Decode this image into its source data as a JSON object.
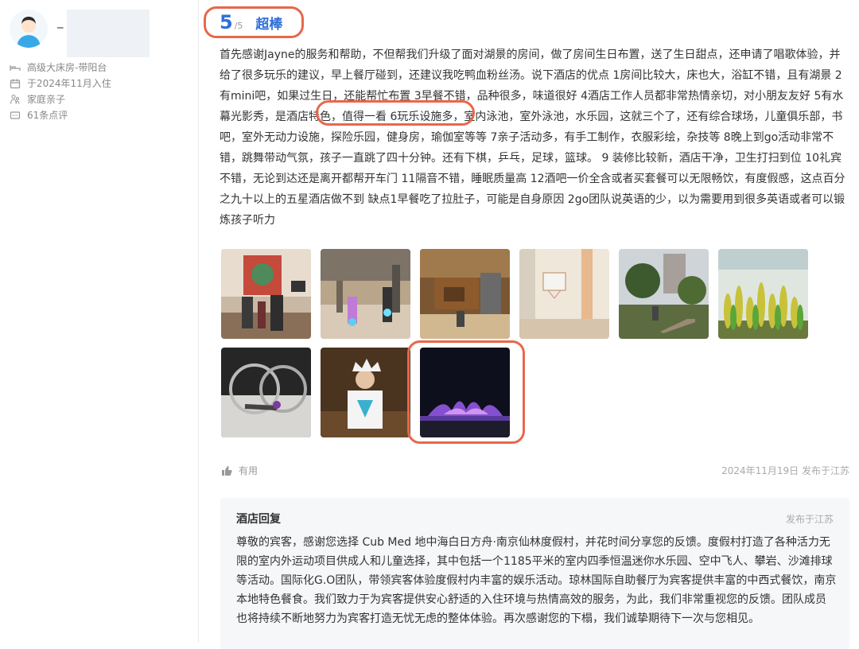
{
  "user": {
    "name_masked": "_ ****",
    "room_type": "高级大床房-带阳台",
    "checkin": "于2024年11月入住",
    "trip_type": "家庭亲子",
    "review_count": "61条点评"
  },
  "rating": {
    "score": "5",
    "out_of": "/5",
    "word": "超棒",
    "color": "#2f6fd8"
  },
  "review": {
    "text": "首先感谢Jayne的服务和帮助，不但帮我们升级了面对湖景的房间，做了房间生日布置，送了生日甜点，还申请了唱歌体验，并给了很多玩乐的建议，早上餐厅碰到，还建议我吃鸭血粉丝汤。说下酒店的优点 1房间比较大，床也大，浴缸不错，且有湖景 2有mini吧，如果过生日，还能帮忙布置 3早餐不错，品种很多，味道很好 4酒店工作人员都非常热情亲切，对小朋友友好 5有水幕光影秀，是酒店特色，值得一看 6玩乐设施多，室内泳池，室外泳池，水乐园，这就三个了，还有综合球场，儿童俱乐部，书吧，室外无动力设施，探险乐园，健身房，瑜伽室等等 7亲子活动多，有手工制作，衣服彩绘，杂技等 8晚上到go活动非常不错，跳舞带动气氛，孩子一直跳了四十分钟。还有下棋，乒乓，足球，篮球。 9 装修比较新，酒店干净，卫生打扫到位 10礼宾不错，无论到达还是离开都帮开车门 11隔音不错，睡眠质量高 12酒吧一价全含或者买套餐可以无限畅饮，有度假感，这点百分之九十以上的五星酒店做不到 缺点1早餐吃了拉肚子，可能是自身原因 2go团队说英语的少，以为需要用到很多英语或者可以锻炼孩子听力"
  },
  "footer": {
    "useful_label": "有用",
    "date_location": "2024年11月19日 发布于江苏"
  },
  "hotel_reply": {
    "title": "酒店回复",
    "location": "发布于江苏",
    "text": "尊敬的宾客，感谢您选择 Cub Med 地中海白日方舟·南京仙林度假村，并花时间分享您的反馈。度假村打造了各种活力无限的室内外运动项目供成人和儿童选择，其中包括一个1185平米的室内四季恒温迷你水乐园、空中飞人、攀岩、沙滩排球等活动。国际化G.O团队，带领宾客体验度假村内丰富的娱乐活动。琼林国际自助餐厅为宾客提供丰富的中西式餐饮，南京本地特色餐食。我们致力于为宾客提供安心舒适的入住环境与热情高效的服务，为此，我们非常重视您的反馈。团队成员也将持续不断地努力为宾客打造无忧无虑的整体体验。再次感谢您的下榻，我们诚挚期待下一次与您相见。"
  },
  "annotation_color": "#e8674c"
}
